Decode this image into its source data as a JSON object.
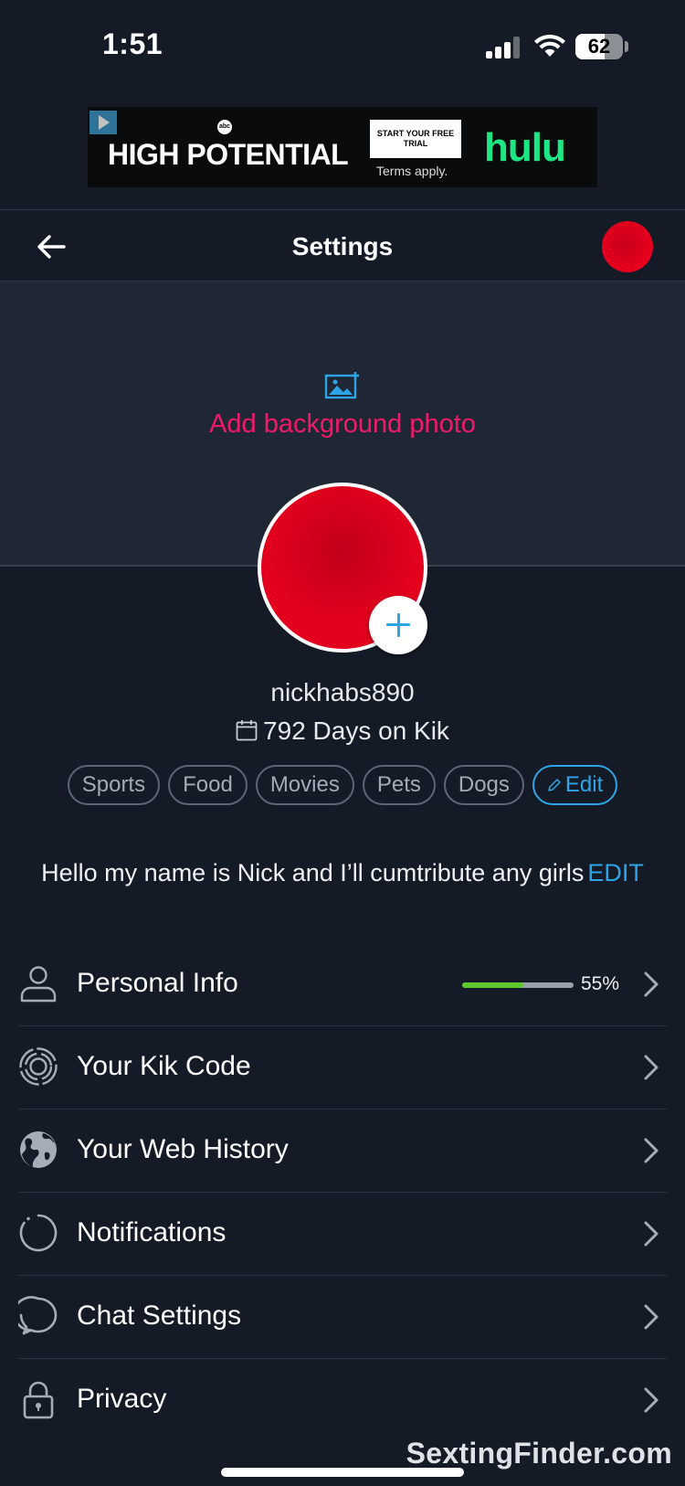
{
  "status_bar": {
    "time": "1:51",
    "battery": "62",
    "battery_fraction": 0.62,
    "signal_icon": "cellular-signal-icon",
    "wifi_icon": "wifi-icon"
  },
  "ad": {
    "title": "HIGH POTENTIAL",
    "network_logo": "abc",
    "cta": "START YOUR FREE TRIAL",
    "terms": "Terms apply.",
    "brand": "hulu",
    "brand_color": "#1ce783"
  },
  "nav": {
    "title": "Settings",
    "back_icon": "arrow-left-icon"
  },
  "background": {
    "add_photo_label": "Add background photo",
    "accent_color": "#f2196b"
  },
  "profile": {
    "username": "nickhabs890",
    "days_on_kik": "792 Days on Kik",
    "avatar_color": "#e1001d",
    "interests": [
      "Sports",
      "Food",
      "Movies",
      "Pets",
      "Dogs"
    ],
    "edit_interests_label": "Edit",
    "bio": "Hello my name is Nick and I’ll cumtribute any girls",
    "bio_edit_label": "EDIT"
  },
  "menu": {
    "items": [
      {
        "label": "Personal Info",
        "icon": "person-icon",
        "progress": 0.55,
        "progress_label": "55%"
      },
      {
        "label": "Your Kik Code",
        "icon": "kik-code-icon"
      },
      {
        "label": "Your Web History",
        "icon": "globe-icon"
      },
      {
        "label": "Notifications",
        "icon": "notification-ring-icon"
      },
      {
        "label": "Chat Settings",
        "icon": "chat-bubble-icon"
      },
      {
        "label": "Privacy",
        "icon": "lock-icon"
      }
    ]
  },
  "watermark": "SextingFinder.com",
  "theme": {
    "background": "#141b27",
    "link_blue": "#2ca4e6",
    "progress_green": "#5ec72a"
  }
}
